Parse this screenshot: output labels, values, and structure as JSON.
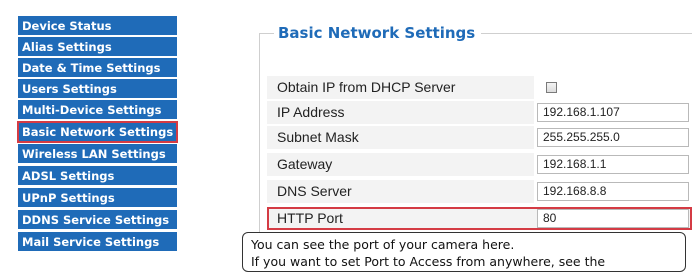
{
  "sidebar": {
    "items": [
      {
        "label": "Device Status"
      },
      {
        "label": "Alias Settings"
      },
      {
        "label": "Date & Time Settings"
      },
      {
        "label": "Users Settings"
      },
      {
        "label": "Multi-Device Settings"
      },
      {
        "label": "Basic Network Settings",
        "selected": true
      },
      {
        "label": "Wireless LAN Settings"
      },
      {
        "label": "ADSL Settings"
      },
      {
        "label": "UPnP Settings"
      },
      {
        "label": "DDNS Service Settings"
      },
      {
        "label": "Mail Service Settings"
      }
    ]
  },
  "main": {
    "title": "Basic Network Settings",
    "fields": {
      "dhcp": {
        "label": "Obtain IP from DHCP Server",
        "checked": false
      },
      "ip_address": {
        "label": "IP Address",
        "value": "192.168.1.107"
      },
      "subnet_mask": {
        "label": "Subnet Mask",
        "value": "255.255.255.0"
      },
      "gateway": {
        "label": "Gateway",
        "value": "192.168.1.1"
      },
      "dns_server": {
        "label": "DNS Server",
        "value": "192.168.8.8"
      },
      "http_port": {
        "label": "HTTP Port",
        "value": "80"
      }
    }
  },
  "tooltip": {
    "line1": "You can see the port of your camera here.",
    "line2": "If you want to set Port to Access from anywhere, see the"
  },
  "colors": {
    "accent": "#1f6bb8",
    "highlight": "#d43b44"
  }
}
